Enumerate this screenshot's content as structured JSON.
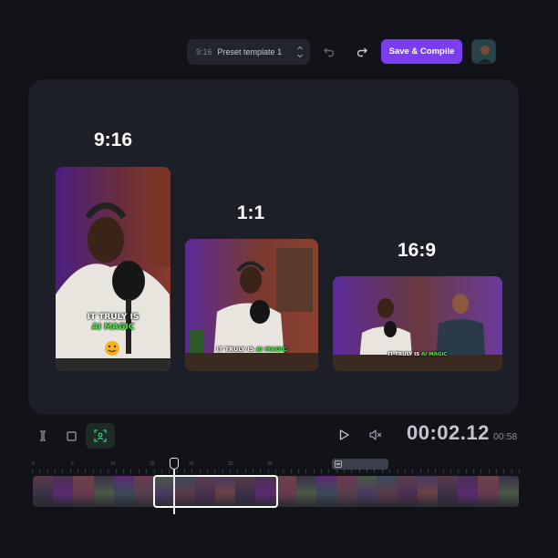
{
  "toolbar": {
    "preset_ratio": "9:16",
    "preset_name": "Preset template 1",
    "save_label": "Save & Compile"
  },
  "preview": {
    "formats": [
      {
        "label": "9:16",
        "caption_top": "IT TRULY IS",
        "caption_highlight": "AI MAGIC"
      },
      {
        "label": "1:1",
        "caption_top": "IT TRULY IS",
        "caption_highlight": "AI MAGIC"
      },
      {
        "label": "16:9",
        "caption_top": "IT TRULY IS",
        "caption_highlight": "AI MAGIC"
      }
    ]
  },
  "player": {
    "current_time": "00:02.12",
    "duration": "00:58"
  },
  "timeline": {
    "ruler_labels": [
      "0",
      "5",
      "10",
      "15",
      "20",
      "25",
      "30"
    ]
  },
  "colors": {
    "accent": "#7a3df0",
    "caption_highlight": "#3df23d",
    "background": "#111319",
    "panel": "#1c1f28"
  },
  "icons": [
    "chevron-updown-icon",
    "undo-icon",
    "redo-icon",
    "split-icon",
    "stop-icon",
    "crop-focus-icon",
    "play-icon",
    "mute-icon",
    "caption-tag-icon"
  ]
}
